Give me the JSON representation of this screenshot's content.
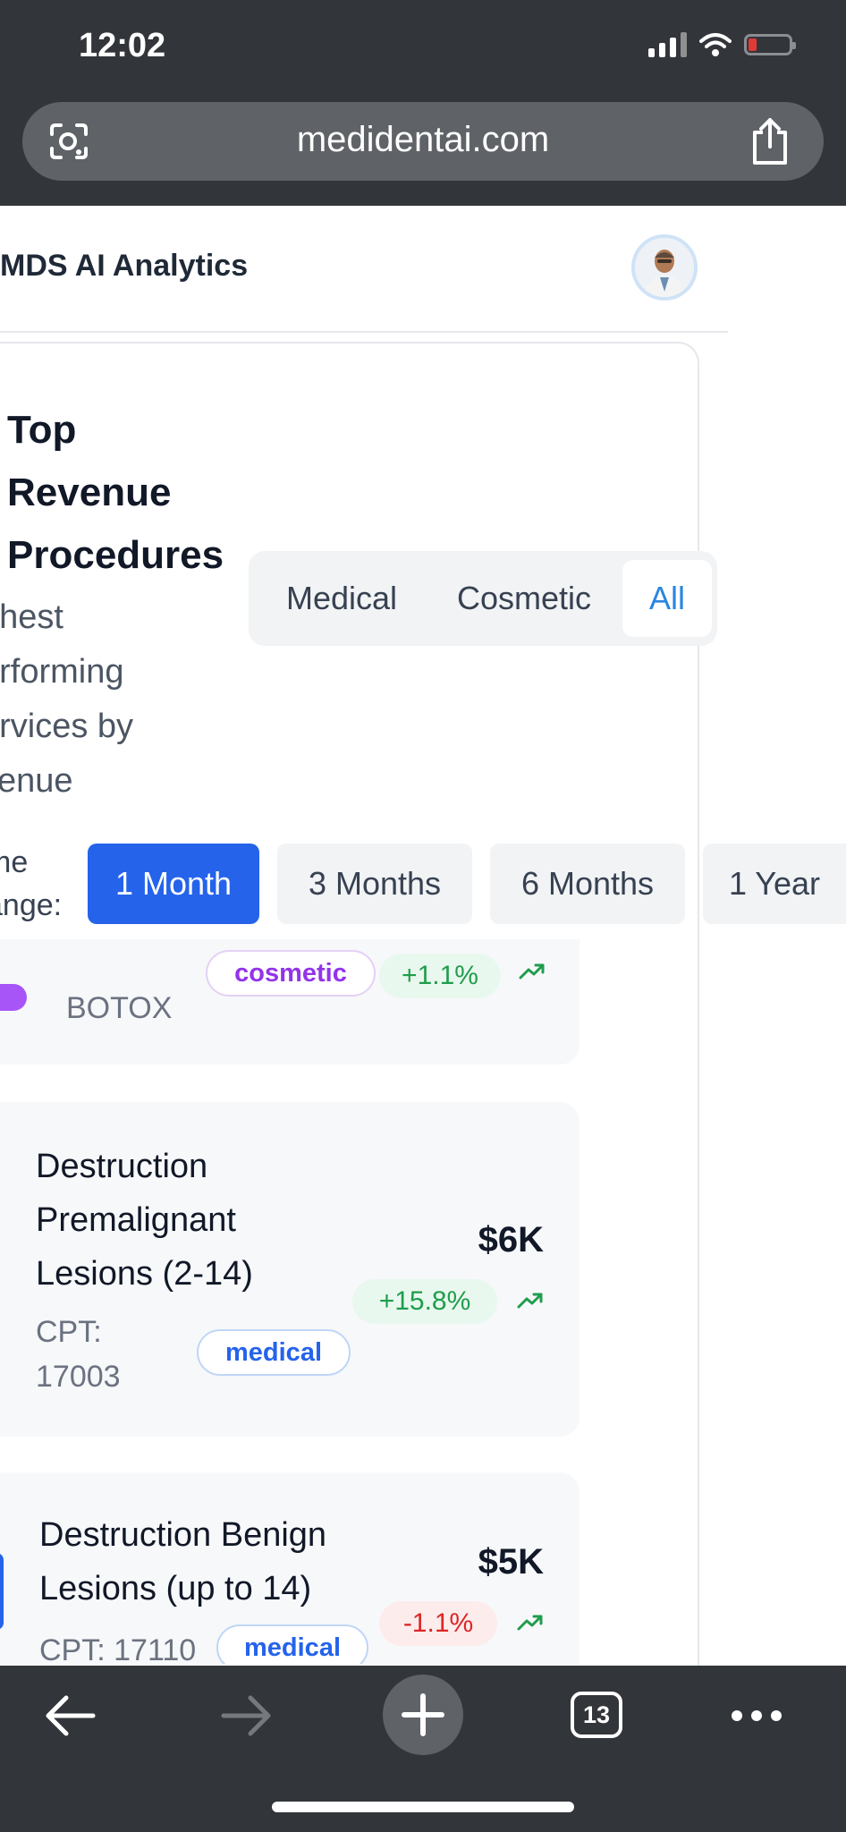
{
  "status_bar": {
    "time": "12:02"
  },
  "browser": {
    "url": "medidentai.com",
    "tab_count": "13"
  },
  "header": {
    "app_title": "MDS AI Analytics"
  },
  "card": {
    "title": "Top Revenue Procedures",
    "subtitle": "ghest erforming ervices by venue",
    "subtitle_lines": [
      "ghest",
      "erforming",
      "ervices by",
      "venue"
    ],
    "title_lines": [
      "Top",
      "Revenue",
      "Procedures"
    ],
    "category_tabs": [
      {
        "label": "Medical",
        "active": false
      },
      {
        "label": "Cosmetic",
        "active": false
      },
      {
        "label": "All",
        "active": true
      }
    ],
    "time_range_label_lines": [
      "me",
      "ange:"
    ],
    "time_ranges": [
      {
        "label": "1 Month",
        "active": true
      },
      {
        "label": "3 Months",
        "active": false
      },
      {
        "label": "6 Months",
        "active": false
      },
      {
        "label": "1 Year",
        "active": false
      }
    ]
  },
  "procedures": [
    {
      "cpt": "BOTOX",
      "category": "cosmetic",
      "change": "+1.1%",
      "trend": "up"
    },
    {
      "name_lines": [
        "Destruction",
        "Premalignant",
        "Lesions (2-14)"
      ],
      "cpt_lines": [
        "CPT:",
        "17003"
      ],
      "category": "medical",
      "revenue": "$6K",
      "change": "+15.8%",
      "trend": "up"
    },
    {
      "name_lines": [
        "Destruction Benign",
        "Lesions (up to 14)"
      ],
      "cpt": "CPT: 17110",
      "category": "medical",
      "revenue": "$5K",
      "change": "-1.1%",
      "trend": "up"
    }
  ],
  "colors": {
    "primary": "#2563eb",
    "positive": "#1f9d4c",
    "negative": "#dc2626",
    "cosmetic": "#9333ea",
    "chrome": "#32353a"
  },
  "icons": [
    "lens-icon",
    "share-icon",
    "back-arrow-icon",
    "forward-arrow-icon",
    "new-tab-plus-icon",
    "tabs-icon",
    "more-icon",
    "trend-up-icon"
  ]
}
